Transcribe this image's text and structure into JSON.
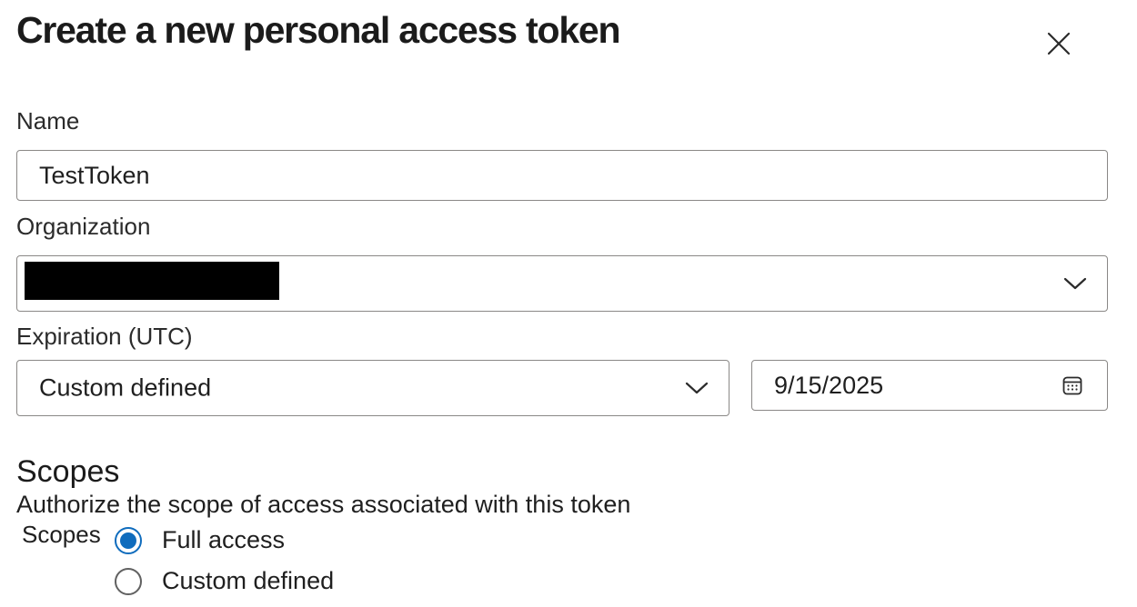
{
  "dialog": {
    "title": "Create a new personal access token"
  },
  "name_field": {
    "label": "Name",
    "value": "TestToken"
  },
  "organization_field": {
    "label": "Organization",
    "value": ""
  },
  "expiration": {
    "label": "Expiration (UTC)",
    "preset_value": "Custom defined",
    "date_value": "9/15/2025"
  },
  "scopes": {
    "title": "Scopes",
    "description": "Authorize the scope of access associated with this token",
    "group_label": "Scopes",
    "options": [
      {
        "label": "Full access",
        "selected": true
      },
      {
        "label": "Custom defined",
        "selected": false
      }
    ]
  },
  "colors": {
    "accent": "#0f6cbd",
    "border": "#8a8886",
    "text": "#1f1f1f"
  },
  "icons": {
    "close": "close-icon",
    "chevron": "chevron-down-icon",
    "calendar": "calendar-icon"
  }
}
